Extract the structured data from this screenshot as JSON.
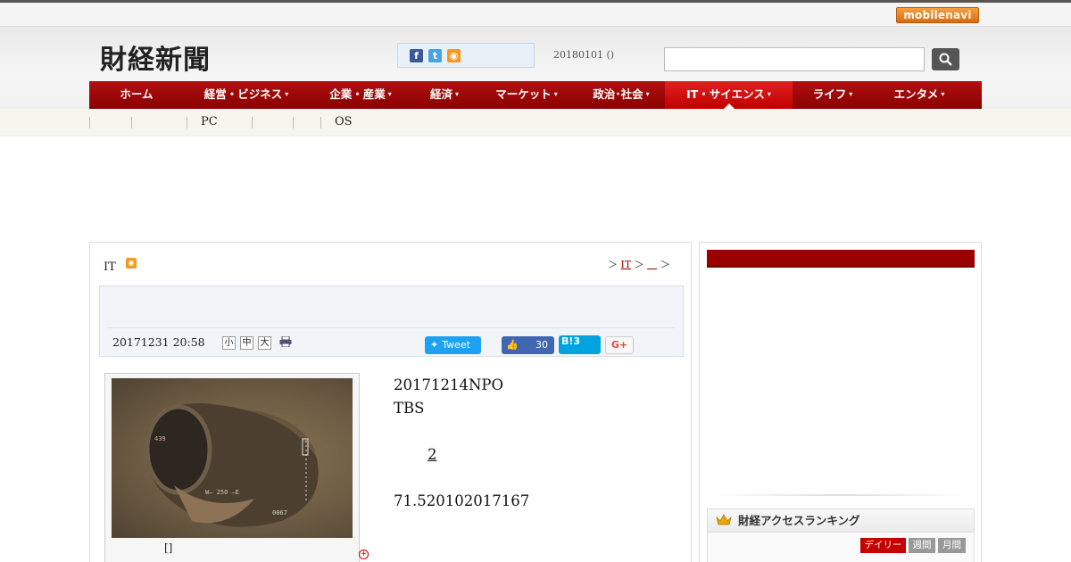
{
  "top": {
    "mobilenavi_label_1": "mobile",
    "mobilenavi_label_2": "navi"
  },
  "header": {
    "logo": "財経新聞",
    "date": "20180101 ()",
    "search": {
      "placeholder": "",
      "button_icon": "search-icon"
    },
    "social_icons": [
      "facebook-icon",
      "twitter-icon",
      "rss-icon"
    ]
  },
  "nav": {
    "items": [
      {
        "label": "ホーム",
        "caret": false
      },
      {
        "label": "経営・ビジネス",
        "caret": true
      },
      {
        "label": "企業・産業",
        "caret": true
      },
      {
        "label": "経済",
        "caret": true
      },
      {
        "label": "マーケット",
        "caret": true
      },
      {
        "label": "政治･社会",
        "caret": true
      },
      {
        "label": "IT・サイエンス",
        "caret": true,
        "active": true
      },
      {
        "label": "ライフ",
        "caret": true
      },
      {
        "label": "エンタメ",
        "caret": true
      }
    ],
    "caret_symbol": "▾"
  },
  "subnav": {
    "items": [
      "PC",
      "OS"
    ]
  },
  "article": {
    "category": "IT",
    "breadcrumb": {
      "sep1": "＞",
      "link1": "IT",
      "sep2": "＞",
      "link2": "　",
      "sep3": "＞"
    },
    "published": "20171231 20:58",
    "font_sizes": [
      "小",
      "中",
      "大"
    ],
    "share": {
      "tweet": "Tweet",
      "like_count": "30",
      "hatena": "B!",
      "hatena_count": "3",
      "gplus": "G+"
    },
    "photo_caption": "[]",
    "body": {
      "line1": "20171214NPO",
      "line2": "TBS",
      "link": "2",
      "line4": "71.520102017167"
    }
  },
  "sidebar": {
    "ranking": {
      "title": "財経アクセスランキング",
      "tabs": [
        "デイリー",
        "週間",
        "月間"
      ]
    }
  },
  "colors": {
    "nav_red": "#9a0000",
    "nav_active": "#d01010",
    "accent_orange": "#f39a24"
  }
}
